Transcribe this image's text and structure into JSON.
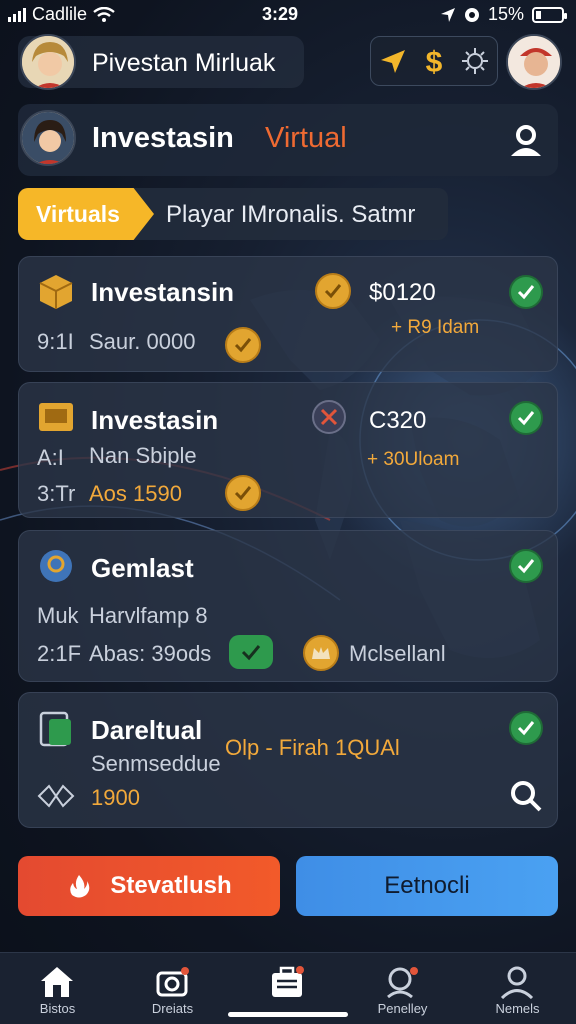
{
  "status_bar": {
    "carrier": "Cadlile",
    "time": "3:29",
    "battery": "15%"
  },
  "header": {
    "title": "Pivestan Mirluak"
  },
  "app_header": {
    "title_main": "Investasin",
    "title_accent": "Virtual"
  },
  "filter": {
    "chip_label": "Virtuals",
    "subtitle": "Playar IMronalis. Satmr"
  },
  "cards": [
    {
      "title": "Investansin",
      "line1": "9:1I",
      "line1_b": "Saur. 0000",
      "amount": "$0120",
      "change": "+ R9 Idam"
    },
    {
      "title": "Investasin",
      "line1": "A:I",
      "line1_b": "Nan Sbiple",
      "line2": "3:Tr",
      "line2_b": "Aos 1590",
      "amount": "C320",
      "change": "+ 30Uloam"
    },
    {
      "title": "Gemlast",
      "line1": "Muk",
      "line1_b": "Harvlfamp 8",
      "line2": "2:1F",
      "line2_b": "Abas: 39ods",
      "side_label": "Mclsellanl"
    },
    {
      "title": "Dareltual",
      "line1_b": "Senmseddue",
      "line2_b": "1900",
      "tag": "Olp - Firah 1QUAl"
    }
  ],
  "buttons": {
    "primary": "Stevatlush",
    "secondary": "Eetnocli"
  },
  "tabs": [
    {
      "label": "Bistos",
      "icon": "home-icon"
    },
    {
      "label": "Dreiats",
      "icon": "camera-icon"
    },
    {
      "label": "",
      "icon": "briefcase-icon"
    },
    {
      "label": "Penelley",
      "icon": "search-person-icon"
    },
    {
      "label": "Nemels",
      "icon": "profile-icon"
    }
  ],
  "colors": {
    "accent_orange": "#ef6a32",
    "chip_yellow": "#f6b728",
    "check_green": "#2e9a4d",
    "button_red": "#e44a30",
    "button_blue": "#4aa1f2"
  }
}
